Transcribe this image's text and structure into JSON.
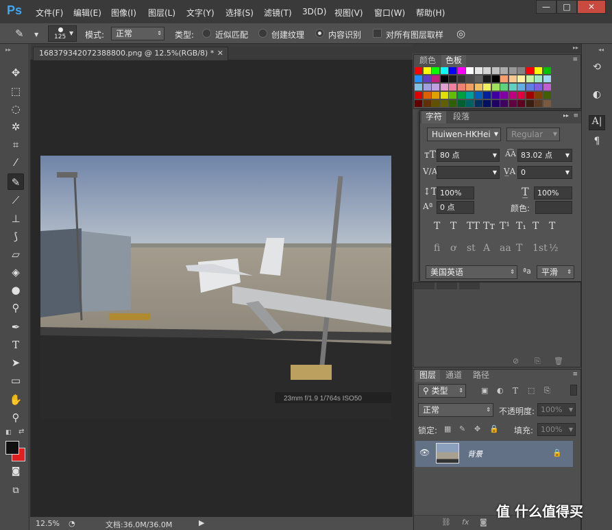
{
  "app": {
    "logo": "Ps"
  },
  "menu": [
    "文件(F)",
    "编辑(E)",
    "图像(I)",
    "图层(L)",
    "文字(Y)",
    "选择(S)",
    "滤镜(T)",
    "3D(D)",
    "视图(V)",
    "窗口(W)",
    "帮助(H)"
  ],
  "window_buttons": [
    "—",
    "□",
    "✕"
  ],
  "options": {
    "brush_size": "125",
    "mode_label": "模式:",
    "mode_value": "正常",
    "type_label": "类型:",
    "type_options": [
      "近似匹配",
      "创建纹理",
      "内容识别"
    ],
    "selected_type": "内容识别",
    "sample_all_label": "对所有图层取样"
  },
  "document": {
    "tab_title": "168379342072388800.png @ 12.5%(RGB/8) *",
    "photo_caption": "23mm f/1.9 1/764s ISO50"
  },
  "status": {
    "zoom": "12.5%",
    "doc_info": "文档:36.0M/36.0M"
  },
  "swatches_panel": {
    "tabs": [
      "颜色",
      "色板"
    ],
    "active": "色板"
  },
  "character_panel": {
    "tabs": [
      "字符",
      "段落"
    ],
    "active": "字符",
    "font_family": "Huiwen-HKHei",
    "font_style": "Regular",
    "font_size": "80 点",
    "leading": "83.02 点",
    "kerning": "",
    "tracking": "0",
    "vertical_scale": "100%",
    "horizontal_scale": "100%",
    "baseline_shift": "0 点",
    "color_label": "颜色:",
    "style_glyphs": [
      "T",
      "T",
      "TT",
      "Tт",
      "T¹",
      "T₁",
      "T",
      "T"
    ],
    "opentype_glyphs": [
      "fi",
      "ơ",
      "st",
      "A",
      "aa",
      "T",
      "1st",
      "½"
    ],
    "language": "美国英语",
    "aa_label": "ªa",
    "antialias": "平滑"
  },
  "layers_panel": {
    "tabs": [
      "图层",
      "通道",
      "路径"
    ],
    "active": "图层",
    "filter_label": "类型",
    "blend_mode": "正常",
    "opacity_label": "不透明度:",
    "opacity": "100%",
    "lock_label": "锁定:",
    "fill_label": "填充:",
    "fill": "100%",
    "layer_name": "背景"
  },
  "watermark": "值 什么值得买",
  "colors": {
    "accent": "#3fa8f4",
    "fg": "#101010",
    "bg": "#e02020"
  }
}
